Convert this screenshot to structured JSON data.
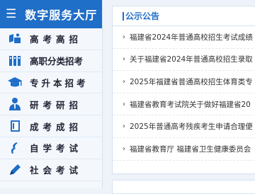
{
  "sidebar": {
    "title": "数字服务大厅",
    "items": [
      {
        "label": "高考高招",
        "icon": "book-reader-icon"
      },
      {
        "label": "高职分类招考",
        "icon": "building-columns-icon"
      },
      {
        "label": "专升本招考",
        "icon": "graduation-cap-icon"
      },
      {
        "label": "研考研招",
        "icon": "user-tie-icon"
      },
      {
        "label": "成考成招",
        "icon": "notebook-icon"
      },
      {
        "label": "自学考试",
        "icon": "pen-nib-icon"
      },
      {
        "label": "社会考试",
        "icon": "pencil-icon"
      }
    ]
  },
  "panel": {
    "title": "公示公告",
    "notices": [
      "福建省2024年普通高校招生考试成绩",
      "关于福建省2024年普通高校招生录取",
      "2025年福建省普通高校招生体育类专",
      "福建省教育考试院关于做好福建省20",
      "2025年普通高考残疾考生申请合理便",
      "福建省教育厅 福建省卫生健康委员会"
    ]
  },
  "colors": {
    "accent": "#1f6ec7",
    "icon": "#1f6ec7"
  }
}
